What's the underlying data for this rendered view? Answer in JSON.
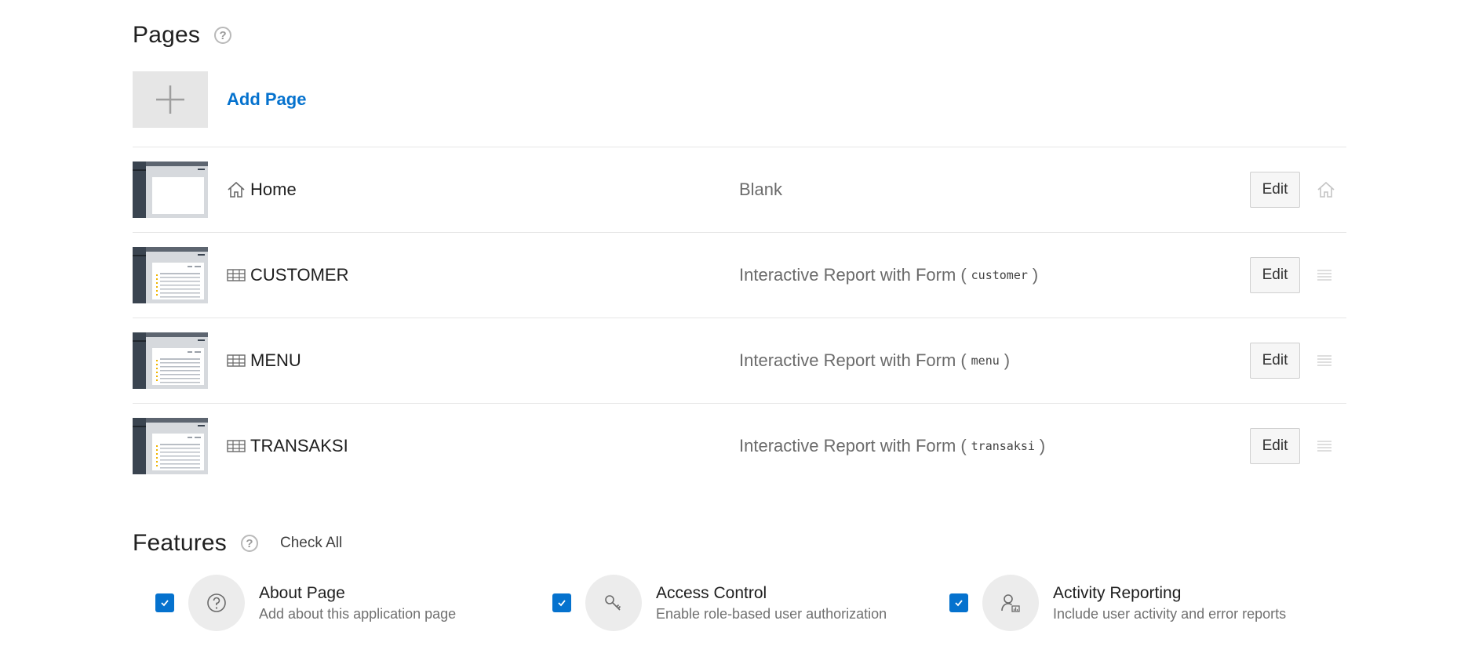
{
  "pages_section": {
    "title": "Pages",
    "help_icon": "question-circle-icon",
    "add_page_label": "Add Page",
    "rows": [
      {
        "name": "Home",
        "icon": "home-icon",
        "type": "Blank",
        "table": "",
        "edit": "Edit",
        "action_icon": "home-icon"
      },
      {
        "name": "CUSTOMER",
        "icon": "table-icon",
        "type": "Interactive Report with Form",
        "table": "customer",
        "edit": "Edit",
        "action_icon": "drag-handle-icon"
      },
      {
        "name": "MENU",
        "icon": "table-icon",
        "type": "Interactive Report with Form",
        "table": "menu",
        "edit": "Edit",
        "action_icon": "drag-handle-icon"
      },
      {
        "name": "TRANSAKSI",
        "icon": "table-icon",
        "type": "Interactive Report with Form",
        "table": "transaksi",
        "edit": "Edit",
        "action_icon": "drag-handle-icon"
      }
    ]
  },
  "features_section": {
    "title": "Features",
    "help_icon": "question-circle-icon",
    "check_all_label": "Check All",
    "items": [
      {
        "title": "About Page",
        "desc": "Add about this application page",
        "icon": "question-circle-icon",
        "checked": true
      },
      {
        "title": "Access Control",
        "desc": "Enable role-based user authorization",
        "icon": "key-icon",
        "checked": true
      },
      {
        "title": "Activity Reporting",
        "desc": "Include user activity and error reports",
        "icon": "user-chart-icon",
        "checked": true
      }
    ]
  },
  "colors": {
    "accent": "#0572ce",
    "thumb_dark": "#3a4450",
    "divider": "#e6e6e6"
  }
}
